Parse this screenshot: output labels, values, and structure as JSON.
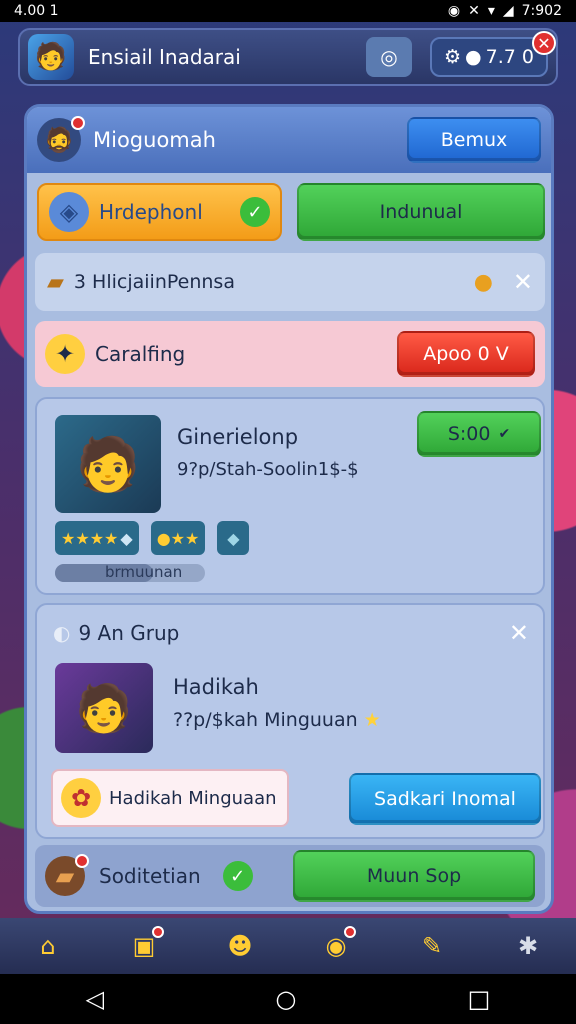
{
  "status_bar": {
    "time": "4.00 1",
    "right_time": "7:902"
  },
  "topbar": {
    "title": "Ensiail Inadarai",
    "coins": "7.7 0"
  },
  "panel": {
    "title": "Mioguomah",
    "header_button": "Bemux",
    "orange_label": "Hrdephonl",
    "green_button": "Indunual",
    "notice": "3 HlicjaiinPennsa",
    "pink_label": "Caralfing",
    "pink_button": "Apoo 0 V",
    "card": {
      "name": "Ginerielonp",
      "subtitle": "9?p/Stah-Soolin1$-$",
      "price_button": "S:00",
      "progress_label": "brmuunan",
      "progress_value": 0.65
    },
    "group": {
      "header": "9 An Grup",
      "name": "Hadikah",
      "subtitle": "??p/$kah Minguuan",
      "reward_label": "Hadikah Minguaan",
      "action_button": "Sadkari Inomal"
    },
    "bottom": {
      "label": "Soditetian",
      "button": "Muun Sop"
    }
  },
  "colors": {
    "accent_blue": "#1f66d0",
    "green": "#2ea636",
    "red": "#d8261a",
    "panel_bg": "#a9bde0"
  }
}
